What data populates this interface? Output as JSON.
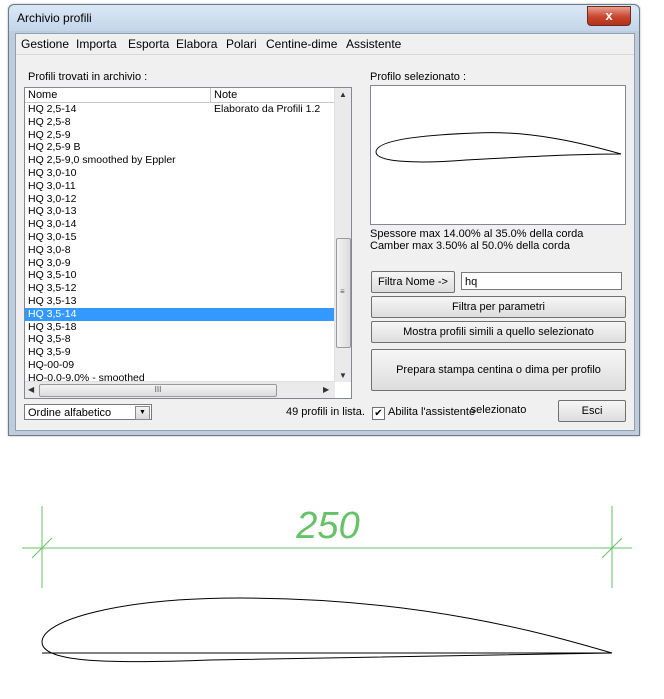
{
  "window": {
    "title": "Archivio profili",
    "close_label": "x"
  },
  "menu": [
    "Gestione",
    "Importa",
    "Esporta",
    "Elabora",
    "Polari",
    "Centine-dime",
    "Assistente"
  ],
  "list_label": "Profili trovati in archivio :",
  "columns": [
    "Nome",
    "Note"
  ],
  "rows": [
    {
      "name": "HQ 2,5-14",
      "note": "Elaborato da Profili 1.2"
    },
    {
      "name": "HQ 2,5-8",
      "note": ""
    },
    {
      "name": "HQ 2,5-9",
      "note": ""
    },
    {
      "name": "HQ 2,5-9 B",
      "note": ""
    },
    {
      "name": "HQ 2,5-9,0 smoothed by Eppler",
      "note": ""
    },
    {
      "name": "HQ 3,0-10",
      "note": ""
    },
    {
      "name": "HQ 3,0-11",
      "note": ""
    },
    {
      "name": "HQ 3,0-12",
      "note": ""
    },
    {
      "name": "HQ 3,0-13",
      "note": ""
    },
    {
      "name": "HQ 3,0-14",
      "note": ""
    },
    {
      "name": "HQ 3,0-15",
      "note": ""
    },
    {
      "name": "HQ 3,0-8",
      "note": ""
    },
    {
      "name": "HQ 3,0-9",
      "note": ""
    },
    {
      "name": "HQ 3,5-10",
      "note": ""
    },
    {
      "name": "HQ 3,5-12",
      "note": ""
    },
    {
      "name": "HQ 3,5-13",
      "note": ""
    },
    {
      "name": "HQ 3,5-14",
      "note": "",
      "selected": true
    },
    {
      "name": "HQ 3,5-18",
      "note": ""
    },
    {
      "name": "HQ 3,5-8",
      "note": ""
    },
    {
      "name": "HQ 3,5-9",
      "note": ""
    },
    {
      "name": "HQ-00-09",
      "note": ""
    },
    {
      "name": "HQ-0,0-9,0% - smoothed",
      "note": ""
    }
  ],
  "scroll_thumb_label": "III",
  "sort_select": {
    "value": "Ordine alfabetico"
  },
  "count_text": "49 profili in lista.",
  "preview_label": "Profilo selezionato :",
  "thickness_text": "Spessore max 14.00% al 35.0% della corda",
  "camber_text": "Camber max 3.50% al 50.0% della corda",
  "filter_name_button": "Filtra Nome ->",
  "filter_name_value": "hq",
  "filter_params_button": "Filtra per parametri",
  "similar_button": "Mostra profili simili a quello selezionato",
  "print_button": "Prepara stampa centina o dima per profilo selezionato",
  "assistant_checkbox": {
    "label": "Abilita l'assistente",
    "checked": true,
    "mark": "✔"
  },
  "exit_button": "Esci",
  "drawing": {
    "dimension_label": "250"
  },
  "colors": {
    "selection": "#3399ff",
    "dimension": "#66c266"
  }
}
